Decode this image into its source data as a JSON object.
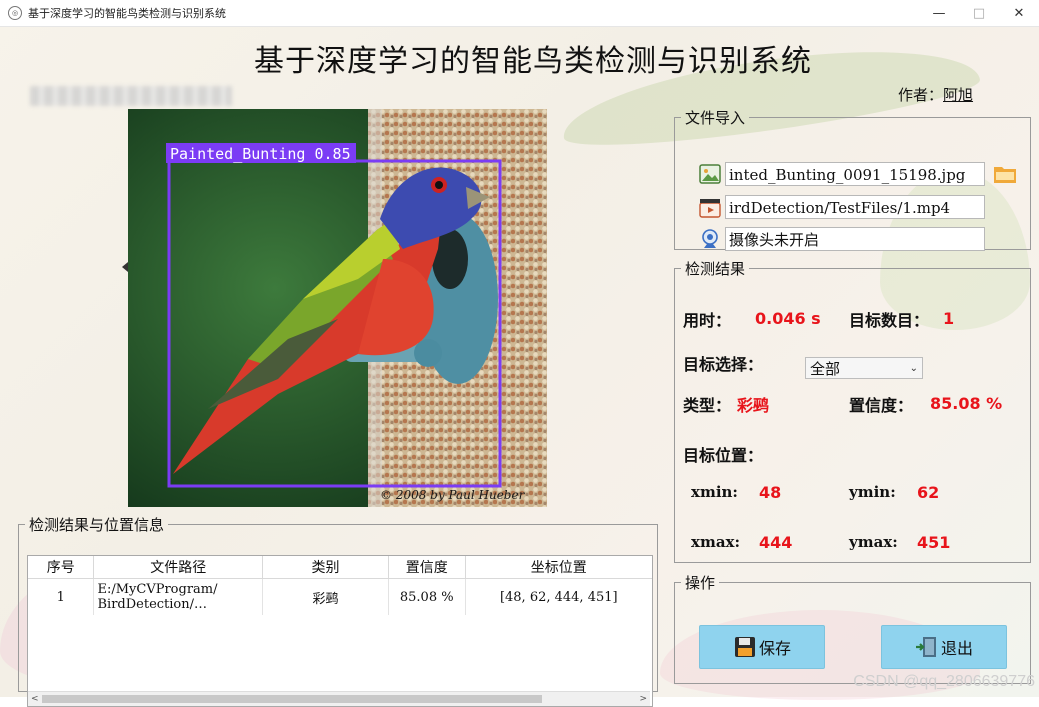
{
  "window": {
    "title": "基于深度学习的智能鸟类检测与识别系统",
    "controls": {
      "minimize": "—",
      "maximize": "□",
      "close": "✕"
    }
  },
  "header": {
    "main_title": "基于深度学习的智能鸟类检测与识别系统",
    "author_label": "作者：",
    "author_name": "阿旭"
  },
  "image_view": {
    "detection_label": "Painted_Bunting 0.85",
    "copyright": "© 2008 by Paul Hueber",
    "box_color": "#7b3cf5"
  },
  "file_import": {
    "legend": "文件导入",
    "image_path": "inted_Bunting_0091_15198.jpg",
    "video_path": "irdDetection/TestFiles/1.mp4",
    "camera_status": "摄像头未开启"
  },
  "results": {
    "legend": "检测结果",
    "time_label": "用时：",
    "time_value": "0.046 s",
    "count_label": "目标数目：",
    "count_value": "1",
    "select_label": "目标选择：",
    "select_value": "全部",
    "type_label": "类型：",
    "type_value": "彩鹀",
    "conf_label": "置信度：",
    "conf_value": "85.08 %",
    "position_label": "目标位置：",
    "xmin_label": "xmin:",
    "xmin_value": "48",
    "ymin_label": "ymin:",
    "ymin_value": "62",
    "xmax_label": "xmax:",
    "xmax_value": "444",
    "ymax_label": "ymax:",
    "ymax_value": "451",
    "value_color": "#e8141b"
  },
  "table": {
    "legend": "检测结果与位置信息",
    "headers": [
      "序号",
      "文件路径",
      "类别",
      "置信度",
      "坐标位置"
    ],
    "rows": [
      {
        "index": "1",
        "path_line1": "E:/MyCVProgram/",
        "path_line2": "BirdDetection/…",
        "category": "彩鹀",
        "confidence": "85.08 %",
        "coords": "[48, 62, 444, 451]"
      }
    ]
  },
  "actions": {
    "legend": "操作",
    "save_label": "保存",
    "exit_label": "退出",
    "button_color": "#8fd3ee"
  },
  "watermark": "CSDN @qq_2806639776"
}
